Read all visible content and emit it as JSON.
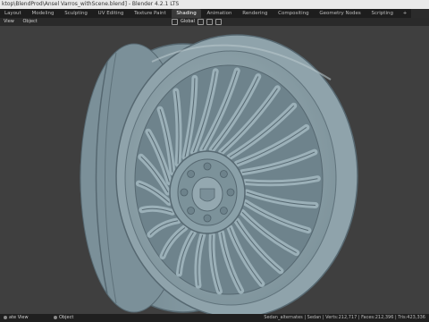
{
  "window": {
    "title": "ktop\\BlendProd\\Ansel Varros_withScene.blend] - Blender 4.2.1 LTS"
  },
  "workspace_tabs": [
    {
      "label": "Layout",
      "active": false
    },
    {
      "label": "Modeling",
      "active": false
    },
    {
      "label": "Sculpting",
      "active": false
    },
    {
      "label": "UV Editing",
      "active": false
    },
    {
      "label": "Texture Paint",
      "active": false
    },
    {
      "label": "Shading",
      "active": true
    },
    {
      "label": "Animation",
      "active": false
    },
    {
      "label": "Rendering",
      "active": false
    },
    {
      "label": "Compositing",
      "active": false
    },
    {
      "label": "Geometry Nodes",
      "active": false
    },
    {
      "label": "Scripting",
      "active": false
    }
  ],
  "add_tab_label": "+",
  "header": {
    "view_label": "View",
    "object_label": "Object",
    "orientation_label": "Global"
  },
  "status": {
    "left_text": "ate View",
    "middle_text": "Object",
    "right_text": "Sedan_alternates | Sedan | Verts:212,717 | Faces:212,396 | Tris:423,336"
  },
  "colors": {
    "wheel_base": "#8a9ea6",
    "wheel_shadow": "#566871",
    "wheel_highlight": "#b7c6cc",
    "viewport_bg": "#3f3f3f"
  }
}
